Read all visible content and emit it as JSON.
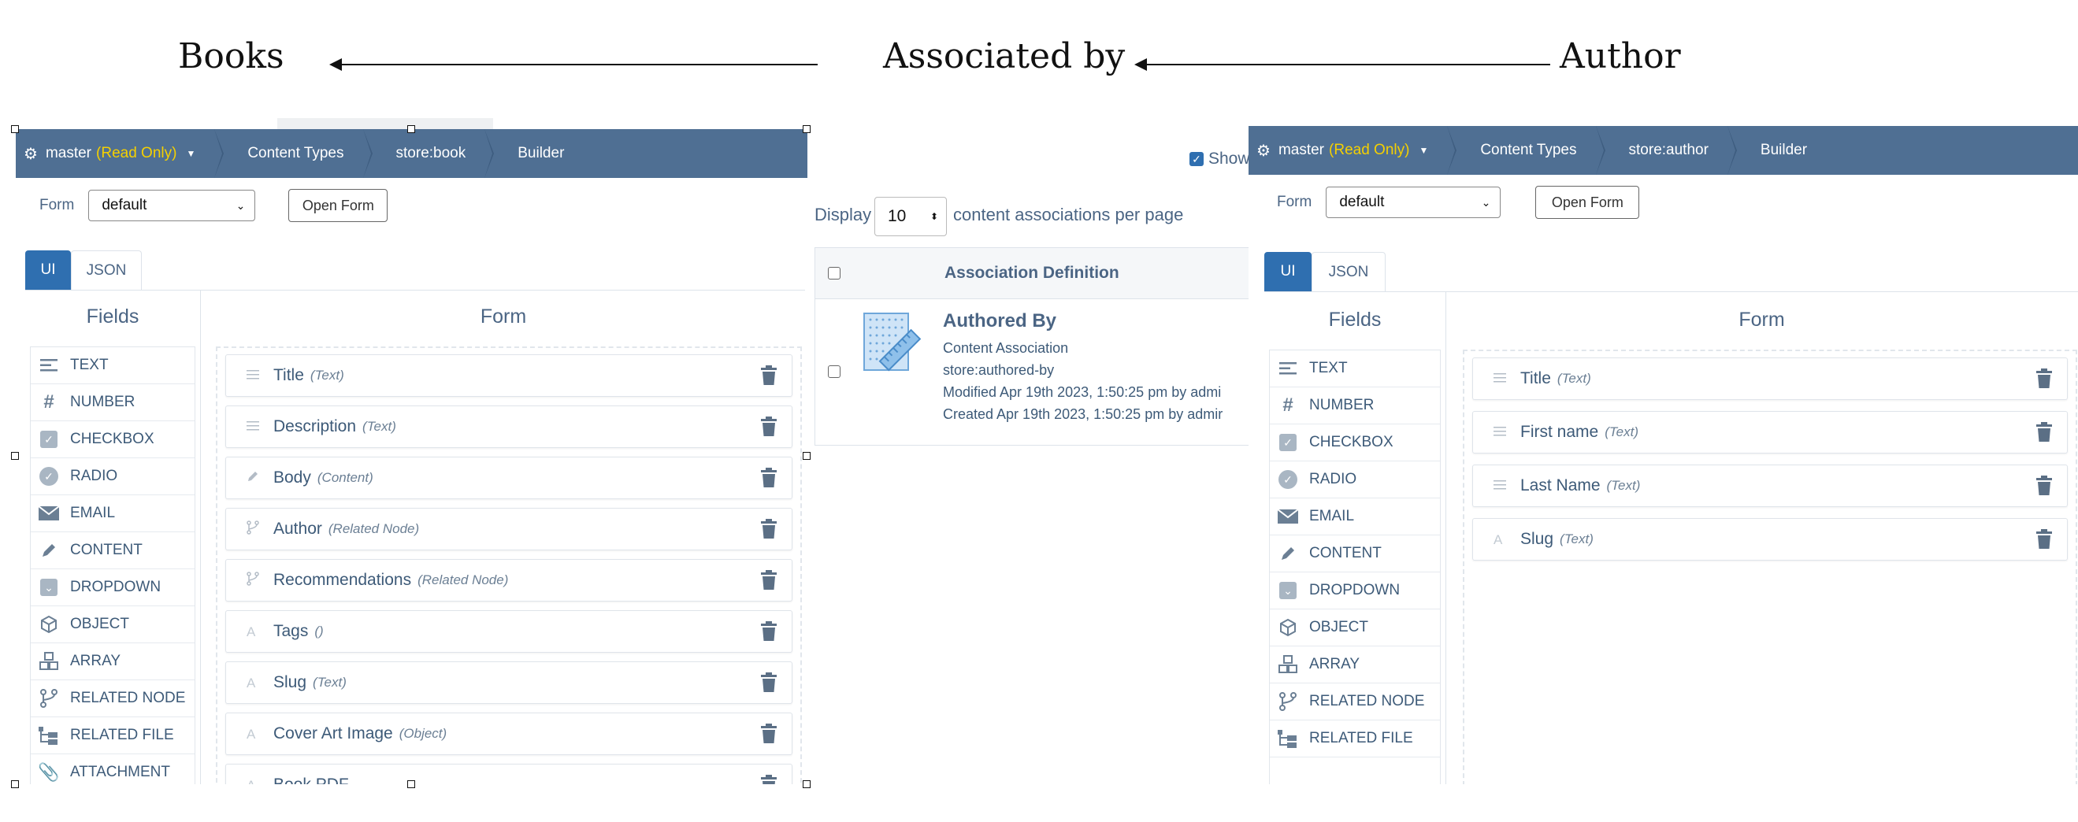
{
  "labels": {
    "books": "Books",
    "associated_by": "Associated by",
    "author": "Author"
  },
  "left": {
    "breadcrumb": {
      "branch": "master",
      "readonly": "(Read Only)",
      "content_types": "Content Types",
      "type": "store:book",
      "builder": "Builder"
    },
    "form_label": "Form",
    "form_select": "default",
    "open_form": "Open Form",
    "tabs": [
      "UI",
      "JSON"
    ],
    "fields_title": "Fields",
    "form_title": "Form",
    "fields": [
      {
        "label": "TEXT",
        "icon": "text-lines-icon"
      },
      {
        "label": "NUMBER",
        "icon": "hash-icon"
      },
      {
        "label": "CHECKBOX",
        "icon": "checkbox-icon"
      },
      {
        "label": "RADIO",
        "icon": "radio-icon"
      },
      {
        "label": "EMAIL",
        "icon": "envelope-icon"
      },
      {
        "label": "CONTENT",
        "icon": "pencil-icon"
      },
      {
        "label": "DROPDOWN",
        "icon": "dropdown-icon"
      },
      {
        "label": "OBJECT",
        "icon": "cube-icon"
      },
      {
        "label": "ARRAY",
        "icon": "cubes-icon"
      },
      {
        "label": "RELATED NODE",
        "icon": "branch-icon"
      },
      {
        "label": "RELATED FILE",
        "icon": "tree-icon"
      },
      {
        "label": "ATTACHMENT",
        "icon": "paperclip-icon"
      }
    ],
    "items": [
      {
        "name": "Title",
        "type": "(Text)",
        "icon": "text-lines-icon"
      },
      {
        "name": "Description",
        "type": "(Text)",
        "icon": "text-lines-icon"
      },
      {
        "name": "Body",
        "type": "(Content)",
        "icon": "pencil-icon"
      },
      {
        "name": "Author",
        "type": "(Related Node)",
        "icon": "branch-icon"
      },
      {
        "name": "Recommendations",
        "type": "(Related Node)",
        "icon": "branch-icon"
      },
      {
        "name": "Tags",
        "type": "()",
        "icon": "letter-a-icon"
      },
      {
        "name": "Slug",
        "type": "(Text)",
        "icon": "letter-a-icon"
      },
      {
        "name": "Cover Art Image",
        "type": "(Object)",
        "icon": "letter-a-icon"
      },
      {
        "name": "Book PDF",
        "type": "",
        "icon": "letter-a-icon"
      }
    ]
  },
  "middle": {
    "show_label": "Show",
    "display_label": "Display",
    "per_page_value": "10",
    "per_page_suffix": "content associations per page",
    "column_header": "Association Definition",
    "row": {
      "title": "Authored By",
      "kind": "Content Association",
      "qname": "store:authored-by",
      "modified": "Modified Apr 19th 2023, 1:50:25 pm by admi",
      "created": "Created Apr 19th 2023, 1:50:25 pm by admir"
    }
  },
  "right": {
    "breadcrumb": {
      "branch": "master",
      "readonly": "(Read Only)",
      "content_types": "Content Types",
      "type": "store:author",
      "builder": "Builder"
    },
    "form_label": "Form",
    "form_select": "default",
    "open_form": "Open Form",
    "tabs": [
      "UI",
      "JSON"
    ],
    "fields_title": "Fields",
    "form_title": "Form",
    "fields": [
      {
        "label": "TEXT",
        "icon": "text-lines-icon"
      },
      {
        "label": "NUMBER",
        "icon": "hash-icon"
      },
      {
        "label": "CHECKBOX",
        "icon": "checkbox-icon"
      },
      {
        "label": "RADIO",
        "icon": "radio-icon"
      },
      {
        "label": "EMAIL",
        "icon": "envelope-icon"
      },
      {
        "label": "CONTENT",
        "icon": "pencil-icon"
      },
      {
        "label": "DROPDOWN",
        "icon": "dropdown-icon"
      },
      {
        "label": "OBJECT",
        "icon": "cube-icon"
      },
      {
        "label": "ARRAY",
        "icon": "cubes-icon"
      },
      {
        "label": "RELATED NODE",
        "icon": "branch-icon"
      },
      {
        "label": "RELATED FILE",
        "icon": "tree-icon"
      }
    ],
    "items": [
      {
        "name": "Title",
        "type": "(Text)",
        "icon": "text-lines-icon"
      },
      {
        "name": "First name",
        "type": "(Text)",
        "icon": "text-lines-icon"
      },
      {
        "name": "Last Name",
        "type": "(Text)",
        "icon": "text-lines-icon"
      },
      {
        "name": "Slug",
        "type": "(Text)",
        "icon": "letter-a-icon"
      }
    ]
  },
  "colors": {
    "breadcrumb_bg": "#4f6f93",
    "readonly": "#f5d000",
    "tab_active": "#2f6fb0",
    "text": "#4b6584"
  }
}
